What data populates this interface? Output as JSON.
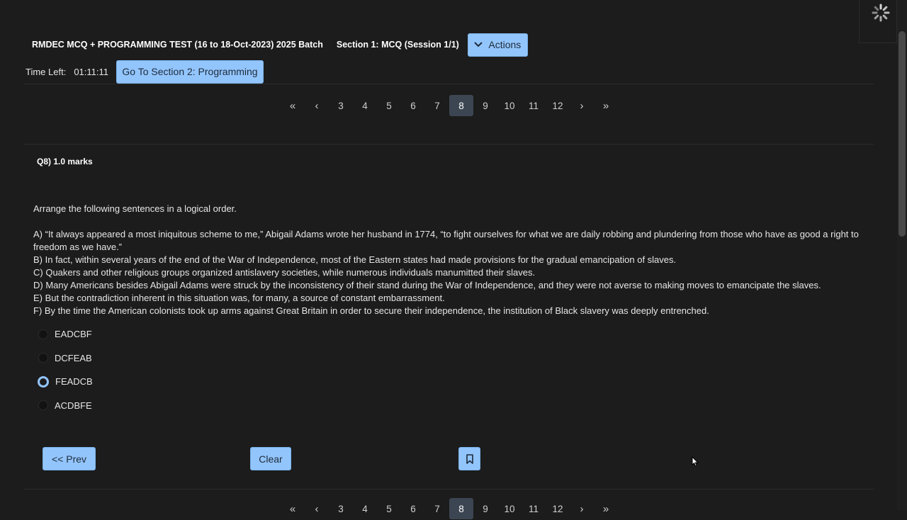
{
  "header": {
    "test_title": "RMDEC MCQ + PROGRAMMING TEST (16 to 18-Oct-2023) 2025 Batch",
    "section_title": "Section 1: MCQ (Session 1/1)",
    "actions_label": "Actions"
  },
  "timer": {
    "label": "Time Left:",
    "value": "01:11:11"
  },
  "go_to_section_label": "Go To Section 2: Programming",
  "pagination": {
    "first": "«",
    "prev": "‹",
    "next": "›",
    "last": "»",
    "pages": [
      "3",
      "4",
      "5",
      "6",
      "7",
      "8",
      "9",
      "10",
      "11",
      "12"
    ],
    "active": "8"
  },
  "question": {
    "marks_label": "Q8) 1.0 marks",
    "instruction": "Arrange the following sentences in a logical order.",
    "sentences": [
      "A) “It always appeared a most iniquitous scheme to me,” Abigail Adams wrote her husband in 1774, “to fight ourselves for what we are daily robbing and plundering from those who have as good a right to freedom as we have.”",
      "B) In fact, within several years of the end of the War of Independence, most of the Eastern states had made provisions for the gradual emancipation of slaves.",
      "C) Quakers and other religious groups organized antislavery societies, while numerous individuals manumitted their slaves.",
      "D) Many Americans besides Abigail Adams were struck by the inconsistency of their stand during the War of Independence, and they were not averse to making moves to emancipate the slaves.",
      "E) But the contradiction inherent in this situation was, for many, a source of constant embarrassment.",
      "F) By the time the American colonists took up arms against Great Britain in order to secure their independence, the institution of Black slavery was deeply entrenched."
    ],
    "options": [
      {
        "label": "EADCBF",
        "selected": false
      },
      {
        "label": "DCFEAB",
        "selected": false
      },
      {
        "label": "FEADCB",
        "selected": true
      },
      {
        "label": "ACDBFE",
        "selected": false
      }
    ]
  },
  "footer": {
    "prev_label": "<< Prev",
    "clear_label": "Clear"
  },
  "icons": {
    "spinner": "loading-spinner-icon",
    "actions": "chevron-down-icon",
    "bookmark": "bookmark-icon"
  },
  "colors": {
    "background": "#1c1c1c",
    "button": "#93c5fd",
    "active_page": "#3c4652"
  }
}
